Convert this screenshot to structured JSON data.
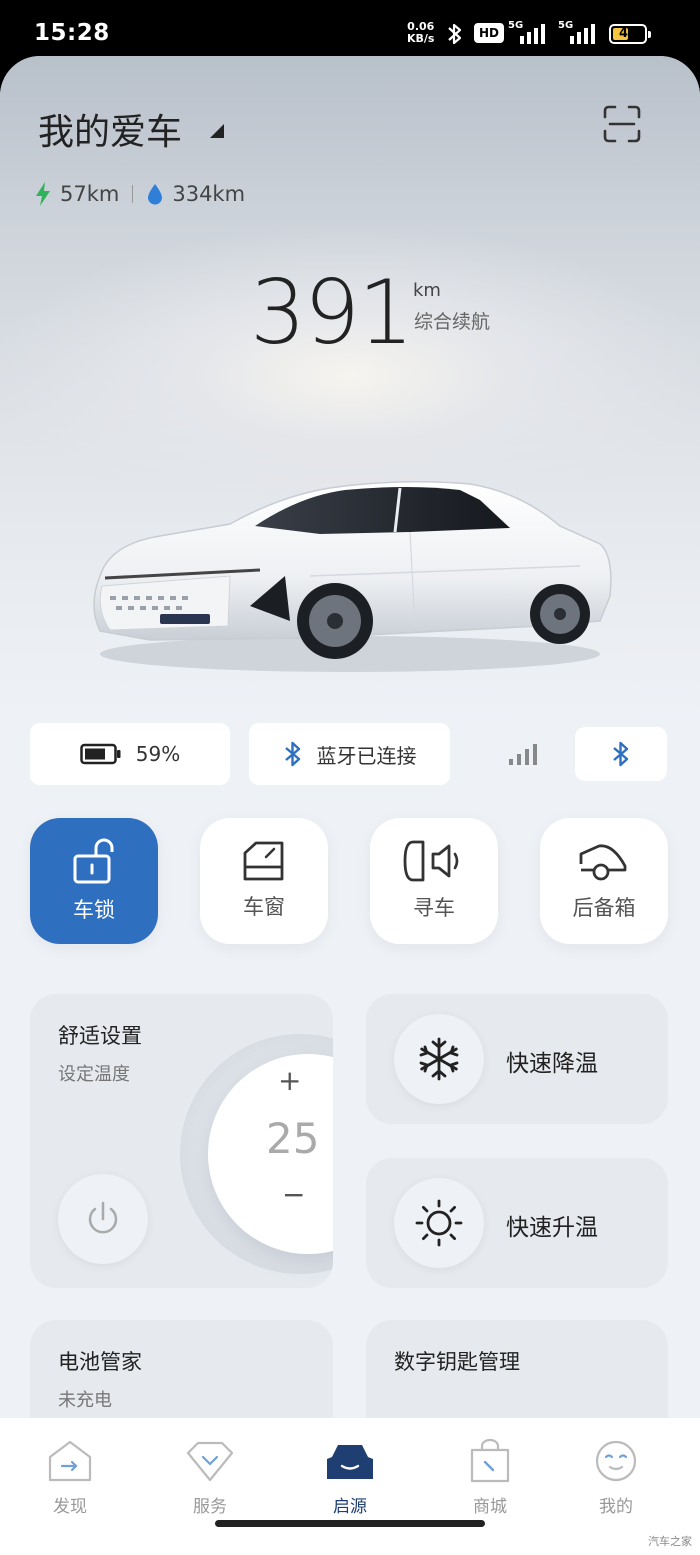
{
  "status_bar": {
    "time": "15:28",
    "net_speed_value": "0.06",
    "net_speed_unit": "KB/s",
    "hd_label": "HD",
    "sim1": "5G",
    "sim2": "5G",
    "battery": "44"
  },
  "header": {
    "title": "我的爱车",
    "ev_range": "57km",
    "fuel_range": "334km"
  },
  "range": {
    "value": "391",
    "unit": "km",
    "label": "综合续航"
  },
  "status_pills": {
    "battery_percent": "59%",
    "bluetooth": "蓝牙已连接"
  },
  "controls": [
    {
      "label": "车锁",
      "active": true
    },
    {
      "label": "车窗",
      "active": false
    },
    {
      "label": "寻车",
      "active": false
    },
    {
      "label": "后备箱",
      "active": false
    }
  ],
  "comfort": {
    "title": "舒适设置",
    "subtitle": "设定温度",
    "plus": "+",
    "temperature": "25",
    "minus": "−"
  },
  "quick_actions": {
    "cool": "快速降温",
    "heat": "快速升温"
  },
  "battery_card": {
    "title": "电池管家",
    "status": "未充电"
  },
  "key_card": {
    "title": "数字钥匙管理"
  },
  "nav": [
    {
      "label": "发现"
    },
    {
      "label": "服务"
    },
    {
      "label": "启源"
    },
    {
      "label": "商城"
    },
    {
      "label": "我的"
    }
  ],
  "watermark": "汽车之家",
  "colors": {
    "accent": "#2f6fc0",
    "ev_green": "#2fb35a",
    "fuel_blue": "#2f7fd8",
    "nav_active": "#1f3f73"
  }
}
